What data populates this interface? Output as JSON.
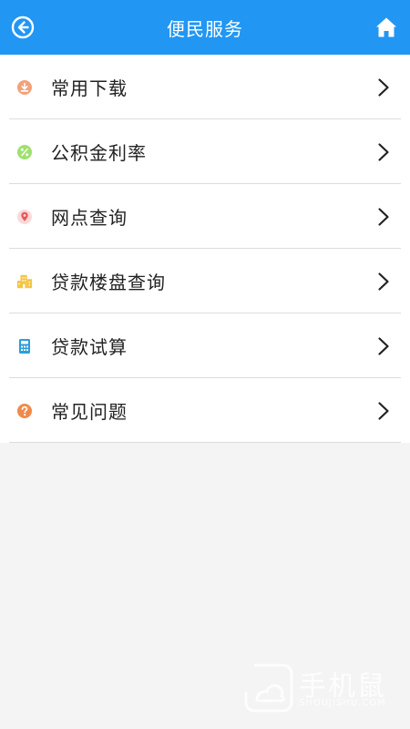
{
  "header": {
    "title": "便民服务",
    "back_icon": "back-arrow-circle-icon",
    "home_icon": "home-icon",
    "color": "#2196f3"
  },
  "menu": {
    "items": [
      {
        "label": "常用下载",
        "icon": "download-icon",
        "icon_color": "#f0a37a"
      },
      {
        "label": "公积金利率",
        "icon": "percent-icon",
        "icon_color": "#9fe06e"
      },
      {
        "label": "网点查询",
        "icon": "location-pin-icon",
        "icon_color": "#f2a0a0"
      },
      {
        "label": "贷款楼盘查询",
        "icon": "building-icon",
        "icon_color": "#f5c542"
      },
      {
        "label": "贷款试算",
        "icon": "calculator-icon",
        "icon_color": "#2a9fd8"
      },
      {
        "label": "常见问题",
        "icon": "question-icon",
        "icon_color": "#f08a4b"
      }
    ]
  },
  "watermark": {
    "main": "手机鼠",
    "sub": "SHOUJISHU.COM"
  }
}
